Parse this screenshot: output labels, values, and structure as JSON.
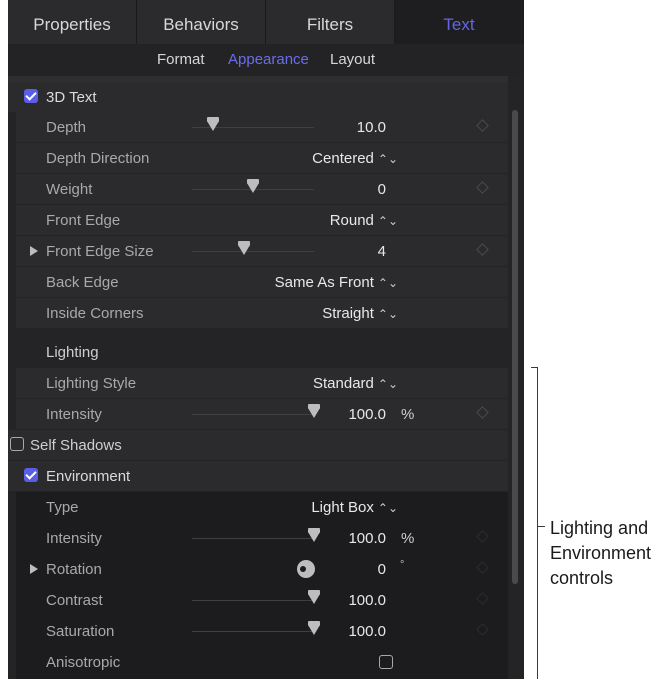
{
  "tabs": [
    "Properties",
    "Behaviors",
    "Filters",
    "Text"
  ],
  "active_tab": "Text",
  "subtabs": [
    "Format",
    "Appearance",
    "Layout"
  ],
  "active_subtab": "Appearance",
  "text3d": {
    "label": "3D Text",
    "checked": true,
    "depth": {
      "label": "Depth",
      "value": "10.0",
      "slider": 0.17
    },
    "depth_direction": {
      "label": "Depth Direction",
      "value": "Centered"
    },
    "weight": {
      "label": "Weight",
      "value": "0",
      "slider": 0.5
    },
    "front_edge": {
      "label": "Front Edge",
      "value": "Round"
    },
    "front_edge_size": {
      "label": "Front Edge Size",
      "value": "4",
      "slider": 0.43
    },
    "back_edge": {
      "label": "Back Edge",
      "value": "Same As Front"
    },
    "inside_corners": {
      "label": "Inside Corners",
      "value": "Straight"
    }
  },
  "lighting": {
    "label": "Lighting",
    "style": {
      "label": "Lighting Style",
      "value": "Standard"
    },
    "intensity": {
      "label": "Intensity",
      "value": "100.0",
      "unit": "%",
      "slider": 1.0
    },
    "self_shadows": {
      "label": "Self Shadows",
      "checked": false
    }
  },
  "environment": {
    "label": "Environment",
    "checked": true,
    "type": {
      "label": "Type",
      "value": "Light Box"
    },
    "intensity": {
      "label": "Intensity",
      "value": "100.0",
      "unit": "%",
      "slider": 1.0
    },
    "rotation": {
      "label": "Rotation",
      "value": "0",
      "unit": "°"
    },
    "contrast": {
      "label": "Contrast",
      "value": "100.0",
      "slider": 1.0
    },
    "saturation": {
      "label": "Saturation",
      "value": "100.0",
      "slider": 1.0
    },
    "anisotropic": {
      "label": "Anisotropic",
      "checked": false
    }
  },
  "callout": {
    "lines": [
      "Lighting and",
      "Environment",
      "controls"
    ]
  },
  "colors": {
    "accent": "#5a5ee6",
    "panel": "#242426",
    "row": "#2b2b2d",
    "env_bg": "#1c1c1e"
  }
}
